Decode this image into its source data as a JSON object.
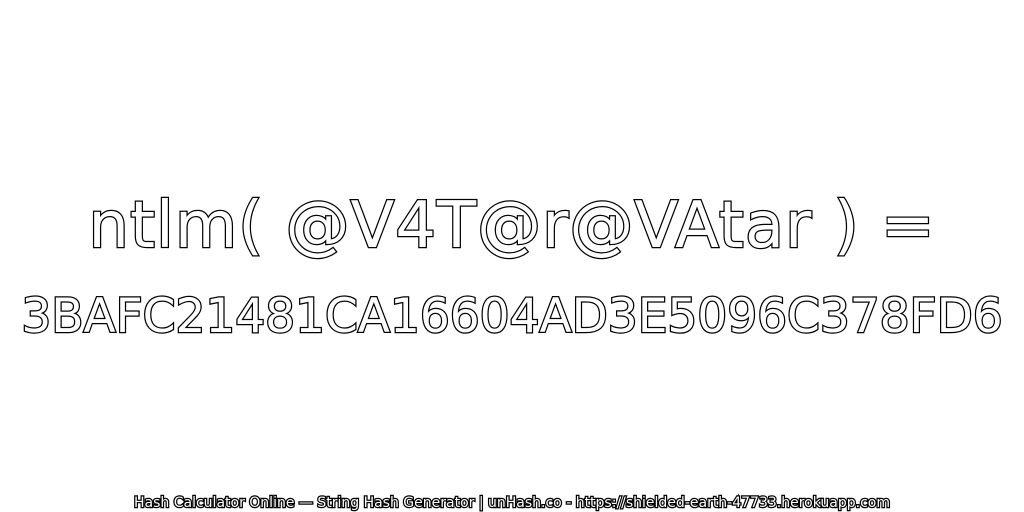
{
  "hash_input_line": "ntlm( @V4T@r@VAtar ) =",
  "hash_output_line": "3BAFC21481CA16604AD3E5096C378FD6",
  "footer_text": "Hash Calculator Online — String Hash Generator | unHash.co - https://shielded-earth-47733.herokuapp.com",
  "colors": {
    "background": "#ffffff",
    "text_fill": "#ffffff",
    "text_outline": "#000000"
  }
}
